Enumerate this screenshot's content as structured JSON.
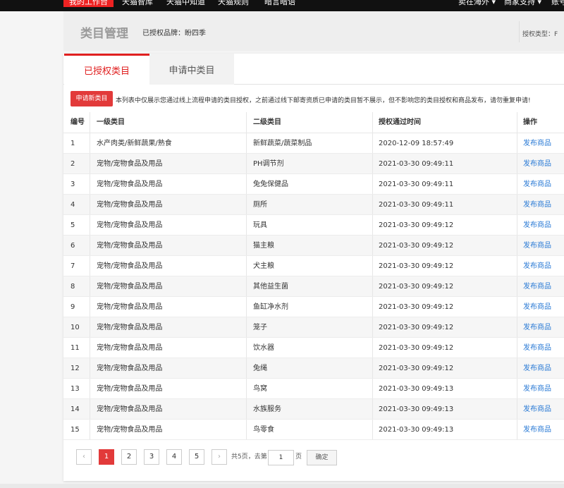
{
  "topbar": {
    "items": [
      "我的工作台",
      "天猫智库",
      "天猫中知道",
      "天猫规则",
      "暗言暗语"
    ],
    "right_items": [
      "卖在海外 ▾",
      "商家支持 ▾",
      "账号"
    ]
  },
  "header": {
    "title": "类目管理",
    "brand_label": "已授权品牌：",
    "brand_value": "盼四季",
    "auth_type": "授权类型：F"
  },
  "tabs": [
    {
      "label": "已授权类目",
      "active": true
    },
    {
      "label": "申请中类目",
      "active": false
    }
  ],
  "apply_button": "申请新类目",
  "notice": "本列表中仅展示您通过线上流程申请的类目授权，之前通过线下邮寄资质已申请的类目暂不展示，但不影响您的类目授权和商品发布，请勿重复申请!",
  "table": {
    "headers": [
      "编号",
      "一级类目",
      "二级类目",
      "授权通过时间",
      "操作"
    ],
    "rows": [
      {
        "id": "1",
        "cat1": "水产肉类/新鲜蔬果/熟食",
        "cat2": "新鲜蔬菜/蔬菜制品",
        "time": "2020-12-09 18:57:49",
        "action": "发布商品"
      },
      {
        "id": "2",
        "cat1": "宠物/宠物食品及用品",
        "cat2": "PH调节剂",
        "time": "2021-03-30 09:49:11",
        "action": "发布商品"
      },
      {
        "id": "3",
        "cat1": "宠物/宠物食品及用品",
        "cat2": "兔兔保健品",
        "time": "2021-03-30 09:49:11",
        "action": "发布商品"
      },
      {
        "id": "4",
        "cat1": "宠物/宠物食品及用品",
        "cat2": "厕所",
        "time": "2021-03-30 09:49:11",
        "action": "发布商品"
      },
      {
        "id": "5",
        "cat1": "宠物/宠物食品及用品",
        "cat2": "玩具",
        "time": "2021-03-30 09:49:12",
        "action": "发布商品"
      },
      {
        "id": "6",
        "cat1": "宠物/宠物食品及用品",
        "cat2": "猫主粮",
        "time": "2021-03-30 09:49:12",
        "action": "发布商品"
      },
      {
        "id": "7",
        "cat1": "宠物/宠物食品及用品",
        "cat2": "犬主粮",
        "time": "2021-03-30 09:49:12",
        "action": "发布商品"
      },
      {
        "id": "8",
        "cat1": "宠物/宠物食品及用品",
        "cat2": "其他益生菌",
        "time": "2021-03-30 09:49:12",
        "action": "发布商品"
      },
      {
        "id": "9",
        "cat1": "宠物/宠物食品及用品",
        "cat2": "鱼缸净水剂",
        "time": "2021-03-30 09:49:12",
        "action": "发布商品"
      },
      {
        "id": "10",
        "cat1": "宠物/宠物食品及用品",
        "cat2": "笼子",
        "time": "2021-03-30 09:49:12",
        "action": "发布商品"
      },
      {
        "id": "11",
        "cat1": "宠物/宠物食品及用品",
        "cat2": "饮水器",
        "time": "2021-03-30 09:49:12",
        "action": "发布商品"
      },
      {
        "id": "12",
        "cat1": "宠物/宠物食品及用品",
        "cat2": "兔绳",
        "time": "2021-03-30 09:49:12",
        "action": "发布商品"
      },
      {
        "id": "13",
        "cat1": "宠物/宠物食品及用品",
        "cat2": "鸟窝",
        "time": "2021-03-30 09:49:13",
        "action": "发布商品"
      },
      {
        "id": "14",
        "cat1": "宠物/宠物食品及用品",
        "cat2": "水族服务",
        "time": "2021-03-30 09:49:13",
        "action": "发布商品"
      },
      {
        "id": "15",
        "cat1": "宠物/宠物食品及用品",
        "cat2": "鸟零食",
        "time": "2021-03-30 09:49:13",
        "action": "发布商品"
      }
    ]
  },
  "pagination": {
    "prev": "‹",
    "next": "›",
    "pages": [
      "1",
      "2",
      "3",
      "4",
      "5"
    ],
    "current": "1",
    "total_text": "共5页，去第",
    "jump_value": "1",
    "page_unit": "页",
    "confirm": "确定"
  },
  "colors": {
    "accent": "#e23a3a",
    "link": "#2a7ad5",
    "topbar": "#111111"
  }
}
